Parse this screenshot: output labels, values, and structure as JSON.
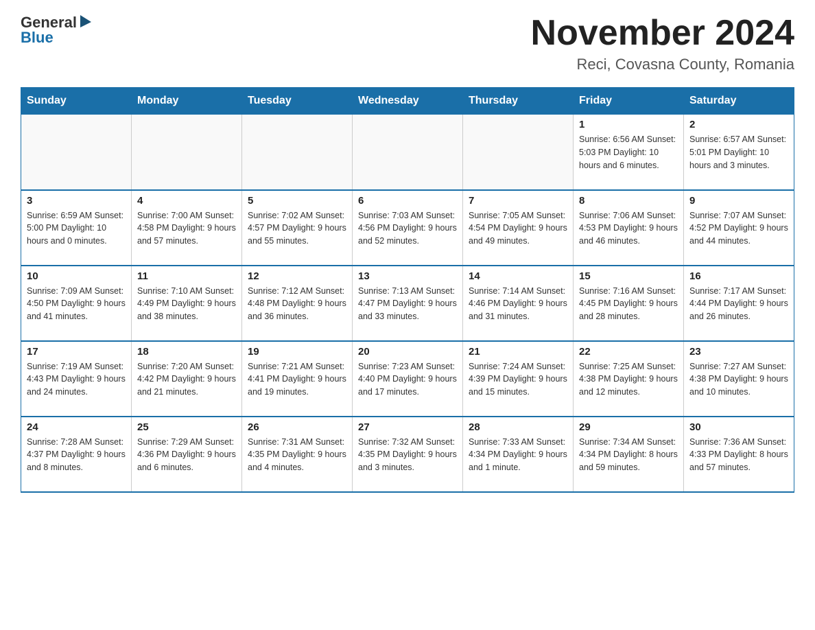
{
  "header": {
    "logo_general": "General",
    "logo_blue": "Blue",
    "month_title": "November 2024",
    "location": "Reci, Covasna County, Romania"
  },
  "calendar": {
    "days_of_week": [
      "Sunday",
      "Monday",
      "Tuesday",
      "Wednesday",
      "Thursday",
      "Friday",
      "Saturday"
    ],
    "weeks": [
      [
        {
          "day": "",
          "info": ""
        },
        {
          "day": "",
          "info": ""
        },
        {
          "day": "",
          "info": ""
        },
        {
          "day": "",
          "info": ""
        },
        {
          "day": "",
          "info": ""
        },
        {
          "day": "1",
          "info": "Sunrise: 6:56 AM\nSunset: 5:03 PM\nDaylight: 10 hours and 6 minutes."
        },
        {
          "day": "2",
          "info": "Sunrise: 6:57 AM\nSunset: 5:01 PM\nDaylight: 10 hours and 3 minutes."
        }
      ],
      [
        {
          "day": "3",
          "info": "Sunrise: 6:59 AM\nSunset: 5:00 PM\nDaylight: 10 hours and 0 minutes."
        },
        {
          "day": "4",
          "info": "Sunrise: 7:00 AM\nSunset: 4:58 PM\nDaylight: 9 hours and 57 minutes."
        },
        {
          "day": "5",
          "info": "Sunrise: 7:02 AM\nSunset: 4:57 PM\nDaylight: 9 hours and 55 minutes."
        },
        {
          "day": "6",
          "info": "Sunrise: 7:03 AM\nSunset: 4:56 PM\nDaylight: 9 hours and 52 minutes."
        },
        {
          "day": "7",
          "info": "Sunrise: 7:05 AM\nSunset: 4:54 PM\nDaylight: 9 hours and 49 minutes."
        },
        {
          "day": "8",
          "info": "Sunrise: 7:06 AM\nSunset: 4:53 PM\nDaylight: 9 hours and 46 minutes."
        },
        {
          "day": "9",
          "info": "Sunrise: 7:07 AM\nSunset: 4:52 PM\nDaylight: 9 hours and 44 minutes."
        }
      ],
      [
        {
          "day": "10",
          "info": "Sunrise: 7:09 AM\nSunset: 4:50 PM\nDaylight: 9 hours and 41 minutes."
        },
        {
          "day": "11",
          "info": "Sunrise: 7:10 AM\nSunset: 4:49 PM\nDaylight: 9 hours and 38 minutes."
        },
        {
          "day": "12",
          "info": "Sunrise: 7:12 AM\nSunset: 4:48 PM\nDaylight: 9 hours and 36 minutes."
        },
        {
          "day": "13",
          "info": "Sunrise: 7:13 AM\nSunset: 4:47 PM\nDaylight: 9 hours and 33 minutes."
        },
        {
          "day": "14",
          "info": "Sunrise: 7:14 AM\nSunset: 4:46 PM\nDaylight: 9 hours and 31 minutes."
        },
        {
          "day": "15",
          "info": "Sunrise: 7:16 AM\nSunset: 4:45 PM\nDaylight: 9 hours and 28 minutes."
        },
        {
          "day": "16",
          "info": "Sunrise: 7:17 AM\nSunset: 4:44 PM\nDaylight: 9 hours and 26 minutes."
        }
      ],
      [
        {
          "day": "17",
          "info": "Sunrise: 7:19 AM\nSunset: 4:43 PM\nDaylight: 9 hours and 24 minutes."
        },
        {
          "day": "18",
          "info": "Sunrise: 7:20 AM\nSunset: 4:42 PM\nDaylight: 9 hours and 21 minutes."
        },
        {
          "day": "19",
          "info": "Sunrise: 7:21 AM\nSunset: 4:41 PM\nDaylight: 9 hours and 19 minutes."
        },
        {
          "day": "20",
          "info": "Sunrise: 7:23 AM\nSunset: 4:40 PM\nDaylight: 9 hours and 17 minutes."
        },
        {
          "day": "21",
          "info": "Sunrise: 7:24 AM\nSunset: 4:39 PM\nDaylight: 9 hours and 15 minutes."
        },
        {
          "day": "22",
          "info": "Sunrise: 7:25 AM\nSunset: 4:38 PM\nDaylight: 9 hours and 12 minutes."
        },
        {
          "day": "23",
          "info": "Sunrise: 7:27 AM\nSunset: 4:38 PM\nDaylight: 9 hours and 10 minutes."
        }
      ],
      [
        {
          "day": "24",
          "info": "Sunrise: 7:28 AM\nSunset: 4:37 PM\nDaylight: 9 hours and 8 minutes."
        },
        {
          "day": "25",
          "info": "Sunrise: 7:29 AM\nSunset: 4:36 PM\nDaylight: 9 hours and 6 minutes."
        },
        {
          "day": "26",
          "info": "Sunrise: 7:31 AM\nSunset: 4:35 PM\nDaylight: 9 hours and 4 minutes."
        },
        {
          "day": "27",
          "info": "Sunrise: 7:32 AM\nSunset: 4:35 PM\nDaylight: 9 hours and 3 minutes."
        },
        {
          "day": "28",
          "info": "Sunrise: 7:33 AM\nSunset: 4:34 PM\nDaylight: 9 hours and 1 minute."
        },
        {
          "day": "29",
          "info": "Sunrise: 7:34 AM\nSunset: 4:34 PM\nDaylight: 8 hours and 59 minutes."
        },
        {
          "day": "30",
          "info": "Sunrise: 7:36 AM\nSunset: 4:33 PM\nDaylight: 8 hours and 57 minutes."
        }
      ]
    ]
  }
}
